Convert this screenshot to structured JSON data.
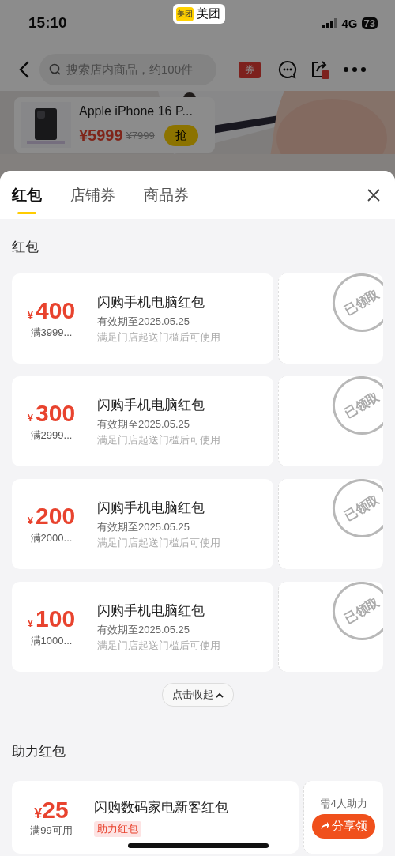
{
  "status_bar": {
    "time": "15:10",
    "app_badge": {
      "logo_text": "美团",
      "name": "美团"
    },
    "network": "4G",
    "battery": "73"
  },
  "nav": {
    "search_placeholder": "搜索店内商品，约100件",
    "coupon_label": "券"
  },
  "product": {
    "title": "Apple iPhone 16 P...",
    "price": "¥5999",
    "original_price": "¥7999",
    "button": "抢"
  },
  "tabs": [
    {
      "label": "红包",
      "selected": true
    },
    {
      "label": "店铺券",
      "selected": false
    },
    {
      "label": "商品券",
      "selected": false
    }
  ],
  "section": {
    "title": "红包",
    "coupons": [
      {
        "currency": "¥",
        "amount": "400",
        "threshold": "满3999...",
        "name": "闪购手机电脑红包",
        "validity": "有效期至2025.05.25",
        "note": "满足门店起送门槛后可使用",
        "stamp": "已领取"
      },
      {
        "currency": "¥",
        "amount": "300",
        "threshold": "满2999...",
        "name": "闪购手机电脑红包",
        "validity": "有效期至2025.05.25",
        "note": "满足门店起送门槛后可使用",
        "stamp": "已领取"
      },
      {
        "currency": "¥",
        "amount": "200",
        "threshold": "满2000...",
        "name": "闪购手机电脑红包",
        "validity": "有效期至2025.05.25",
        "note": "满足门店起送门槛后可使用",
        "stamp": "已领取"
      },
      {
        "currency": "¥",
        "amount": "100",
        "threshold": "满1000...",
        "name": "闪购手机电脑红包",
        "validity": "有效期至2025.05.25",
        "note": "满足门店起送门槛后可使用",
        "stamp": "已领取"
      }
    ],
    "collapse_button": "点击收起"
  },
  "assist_section": {
    "title": "助力红包",
    "coupon": {
      "currency": "¥",
      "amount": "25",
      "threshold": "满99可用",
      "name": "闪购数码家电新客红包",
      "tag": "助力红包",
      "requirement": "需4人助力",
      "button": "分享领"
    }
  }
}
